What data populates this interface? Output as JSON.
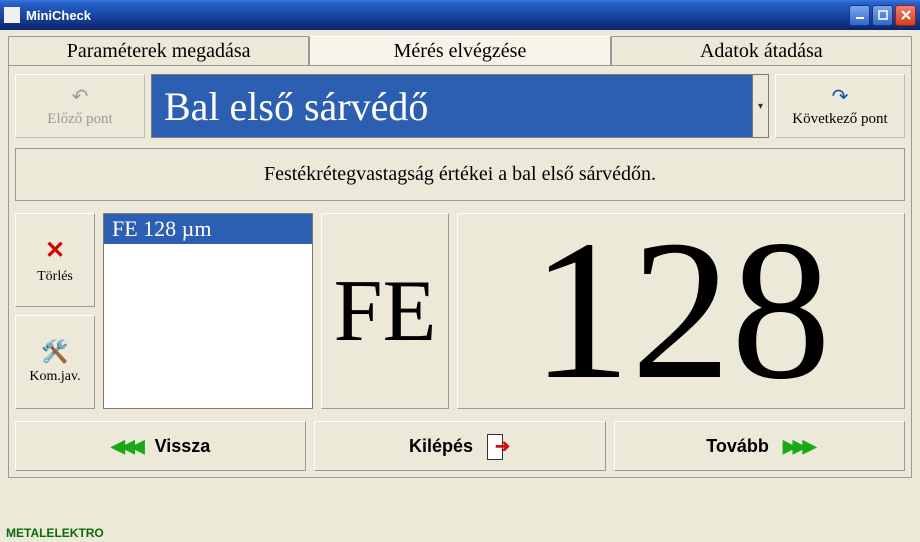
{
  "window": {
    "title": "MiniCheck"
  },
  "tabs": {
    "params": "Paraméterek megadása",
    "measure": "Mérés elvégzése",
    "data": "Adatok átadása"
  },
  "nav": {
    "prev_label": "Előző pont",
    "next_label": "Következő pont"
  },
  "part": {
    "name": "Bal első sárvédő"
  },
  "info": {
    "text": "Festékrétegvastagság értékei a bal első sárvédőn."
  },
  "side": {
    "delete_label": "Törlés",
    "comm_label": "Kom.jav."
  },
  "list": {
    "items": [
      "FE 128 µm"
    ]
  },
  "reading": {
    "material": "FE",
    "value": "128"
  },
  "bottom": {
    "back": "Vissza",
    "exit": "Kilépés",
    "next": "Tovább"
  },
  "footer": "METALELEKTRO"
}
